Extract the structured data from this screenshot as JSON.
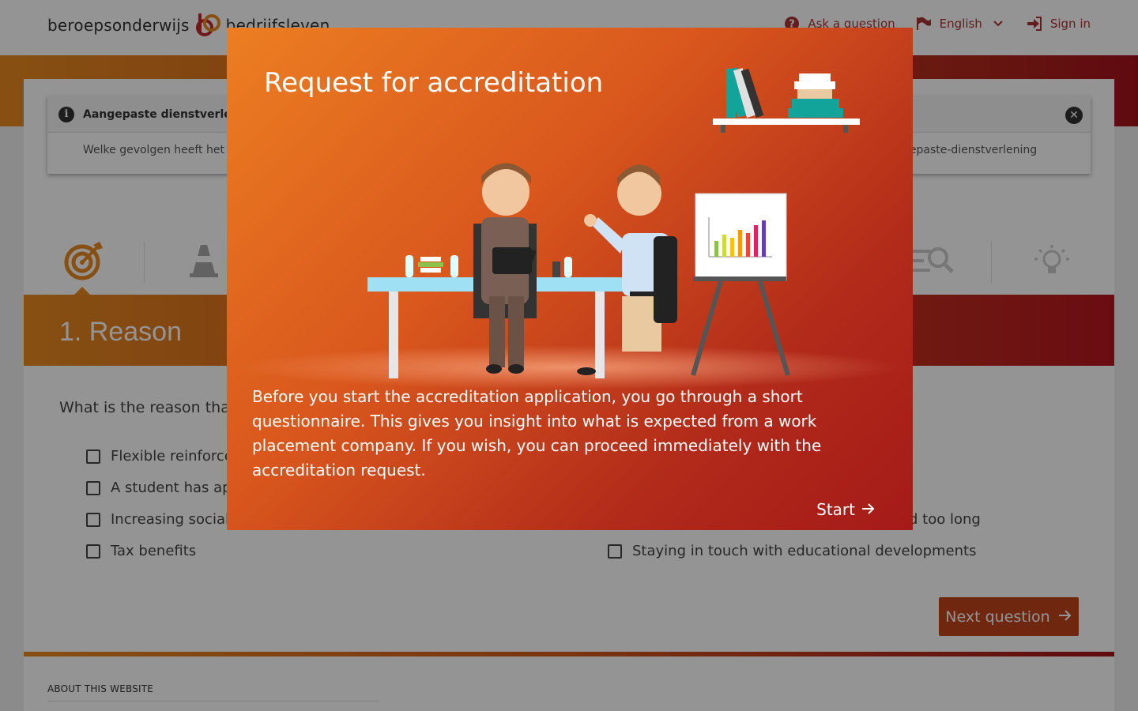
{
  "header": {
    "logo_left": "beroepsonderwijs",
    "logo_right": "bedrijfsleven",
    "nav": {
      "ask": "Ask a question",
      "language": "English",
      "signin": "Sign in"
    }
  },
  "notice": {
    "title": "Aangepaste dienstverlening",
    "body_start": "Welke gevolgen heeft het co",
    "body_end": "gepaste-dienstverlening"
  },
  "steps": {
    "icons": [
      "target-icon",
      "traffic-cone-icon",
      "list-search-icon",
      "lightbulb-icon"
    ]
  },
  "section": {
    "title": "1. Reason",
    "question": "What is the reason that",
    "options_left": [
      "Flexible reinforcem",
      "A student has app",
      "Increasing social e",
      "Tax benefits"
    ],
    "options_right": [
      "d too long",
      "Staying in touch with educational developments"
    ],
    "next_label": "Next question"
  },
  "footer": {
    "about": "ABOUT THIS WEBSITE"
  },
  "modal": {
    "title": "Request for accreditation",
    "text": "Before you start the accreditation application, you go through a short questionnaire. This gives you insight into what is expected from a work placement company. If you wish, you can proceed immediately with the accreditation request.",
    "start_label": "Start"
  },
  "colors": {
    "orange": "#e98a1f",
    "red": "#a5121c",
    "button": "#c0461b",
    "chart_bars": [
      "#8bc34a",
      "#cddc39",
      "#ffc107",
      "#ff9800",
      "#f44336",
      "#e91e63",
      "#673ab7"
    ]
  }
}
